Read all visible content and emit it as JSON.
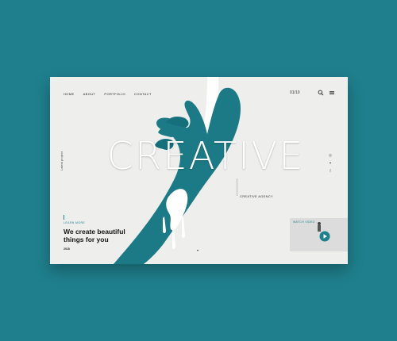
{
  "nav": {
    "items": [
      "HOME",
      "ABOUT",
      "PORTFOLIO",
      "CONTACT"
    ]
  },
  "header": {
    "page_count": "01/10",
    "search_icon": "search-icon",
    "menu_icon": "hamburger-menu-icon"
  },
  "hero": {
    "big_word": "CREATIVE",
    "vertical_label": "Latest project",
    "agency_label": "CREATIVE AGENCY",
    "learn_more": "LEARN MORE",
    "tagline": "We create beautiful things for you",
    "year": "2018"
  },
  "social": [
    "instagram-icon",
    "twitter-icon",
    "facebook-icon"
  ],
  "video": {
    "label": "WATCH VIDEO"
  },
  "colors": {
    "background": "#1f7f8c",
    "card": "#eeeeed",
    "accent": "#1f7f8c",
    "paint": "#1c7a86"
  }
}
